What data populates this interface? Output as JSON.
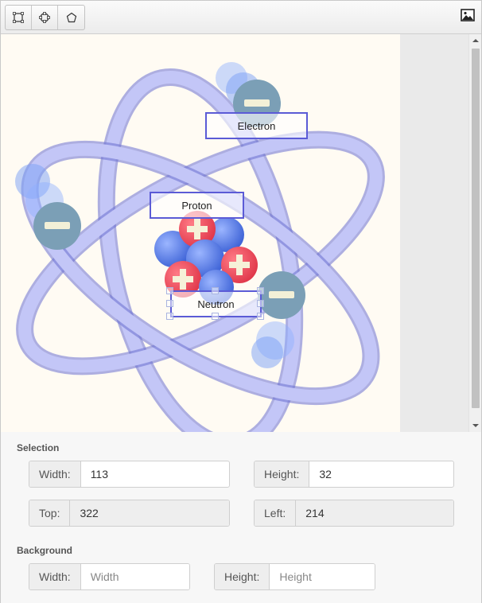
{
  "toolbar": {
    "tools": [
      {
        "name": "rectangle-tool",
        "icon": "square-dashed-icon"
      },
      {
        "name": "circle-tool",
        "icon": "circle-dashed-icon"
      },
      {
        "name": "polygon-tool",
        "icon": "pentagon-icon"
      }
    ],
    "image_button_icon": "image-icon"
  },
  "canvas": {
    "labels": [
      {
        "id": "electron",
        "text": "Electron"
      },
      {
        "id": "proton",
        "text": "Proton"
      },
      {
        "id": "neutron",
        "text": "Neutron",
        "selected": true
      }
    ],
    "colors": {
      "background": "#fffbf3",
      "orbit": "#b9bdf5",
      "orbit_dark": "#6a6fd0",
      "electron": "#7b9fb6",
      "proton": "#e94b5b",
      "neutron": "#5b7fe8",
      "label_border": "#5b5bd6"
    }
  },
  "selection": {
    "title": "Selection",
    "width_label": "Width:",
    "width_value": "113",
    "height_label": "Height:",
    "height_value": "32",
    "top_label": "Top:",
    "top_value": "322",
    "left_label": "Left:",
    "left_value": "214"
  },
  "background": {
    "title": "Background",
    "width_label": "Width:",
    "width_placeholder": "Width",
    "height_label": "Height:",
    "height_placeholder": "Height"
  }
}
